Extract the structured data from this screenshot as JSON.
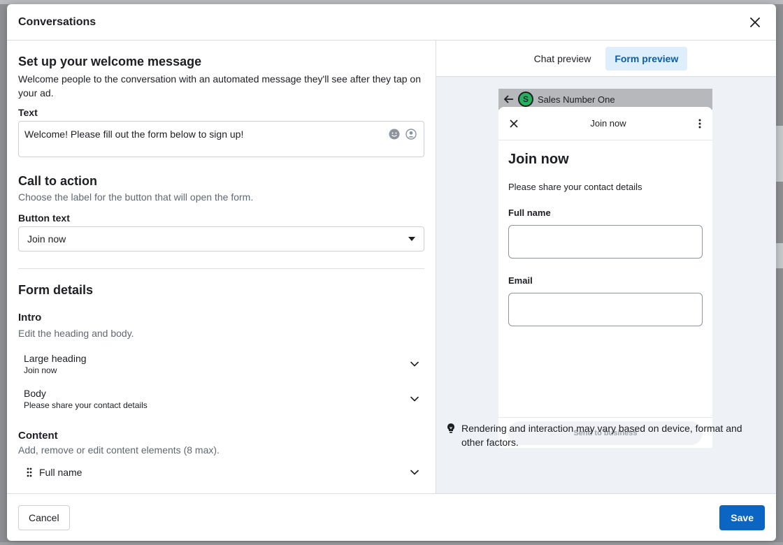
{
  "modal": {
    "title": "Conversations"
  },
  "left": {
    "welcome": {
      "heading": "Set up your welcome message",
      "description": "Welcome people to the conversation with an automated message they'll see after they tap on your ad.",
      "text_label": "Text",
      "text_value": "Welcome! Please fill out the form below to sign up!"
    },
    "cta": {
      "heading": "Call to action",
      "description": "Choose the label for the button that will open the form.",
      "button_text_label": "Button text",
      "button_text_value": "Join now"
    },
    "form_details": {
      "heading": "Form details",
      "intro": {
        "heading": "Intro",
        "description": "Edit the heading and body.",
        "items": [
          {
            "title": "Large heading",
            "value": "Join now"
          },
          {
            "title": "Body",
            "value": "Please share your contact details"
          }
        ]
      },
      "content": {
        "heading": "Content",
        "description": "Add, remove or edit content elements (8 max).",
        "items": [
          {
            "title": "Full name"
          }
        ]
      }
    }
  },
  "right": {
    "tabs": [
      {
        "label": "Chat preview",
        "active": false
      },
      {
        "label": "Form preview",
        "active": true
      }
    ],
    "phone": {
      "contact_name": "Sales Number One",
      "avatar_letter": "S",
      "sheet_title": "Join now",
      "form_heading": "Join now",
      "form_body": "Please share your contact details",
      "fields": [
        {
          "label": "Full name"
        },
        {
          "label": "Email"
        }
      ],
      "send_label": "Send to business"
    },
    "note": "Rendering and interaction may vary based on device, format and other factors."
  },
  "footer": {
    "cancel_label": "Cancel",
    "save_label": "Save"
  },
  "colors": {
    "accent": "#0a66c2",
    "tab_active_bg": "#dfeefb",
    "preview_bg": "#eef1f5",
    "avatar": "#25b15f"
  }
}
